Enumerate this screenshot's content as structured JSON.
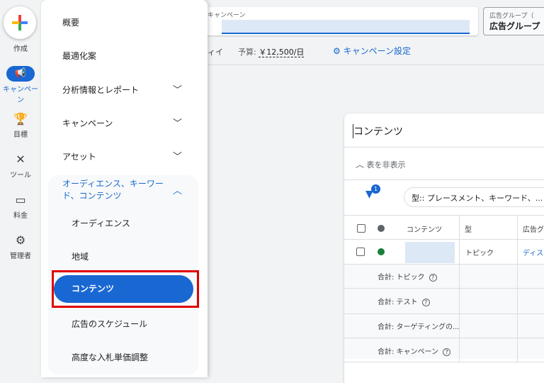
{
  "rail": {
    "create": "作成",
    "items": [
      {
        "label": "キャンペーン",
        "icon": "megaphone-icon"
      },
      {
        "label": "目標",
        "icon": "trophy-icon"
      },
      {
        "label": "ツール",
        "icon": "tools-icon"
      },
      {
        "label": "料金",
        "icon": "credit-card-icon"
      },
      {
        "label": "管理者",
        "icon": "gear-icon"
      }
    ]
  },
  "menu": {
    "items": [
      "概要",
      "最適化案",
      "分析情報とレポート",
      "キャンペーン",
      "アセット"
    ],
    "group": "オーディエンス、キーワード、コンテンツ",
    "sub": [
      "オーディエンス",
      "地域",
      "コンテンツ",
      "広告のスケジュール",
      "高度な入札単価調整"
    ]
  },
  "header": {
    "campaign_label": "キャンペーン",
    "adgroup_label": "広告グループ（",
    "adgroup_value": "広告グループ",
    "status_frag": "ィイ",
    "budget_label": "予算:",
    "budget_value": "￥12,500/日",
    "settings": "キャンペーン設定"
  },
  "card": {
    "title": "コンテンツ",
    "hide_table": "表を非表示",
    "filter_count": "1",
    "filter_chip": "型:: プレースメント、キーワード、...",
    "columns": [
      "コンテンツ",
      "型",
      "広告グ"
    ],
    "row": {
      "type": "トピック",
      "adgroup": "ディス"
    },
    "totals": [
      "合計: トピック",
      "合計: テスト",
      "合計: ターゲティングの...",
      "合計: キャンペーン"
    ]
  },
  "colors": {
    "accent": "#1967d2",
    "highlight": "#e00000",
    "status_enabled": "#188038"
  }
}
